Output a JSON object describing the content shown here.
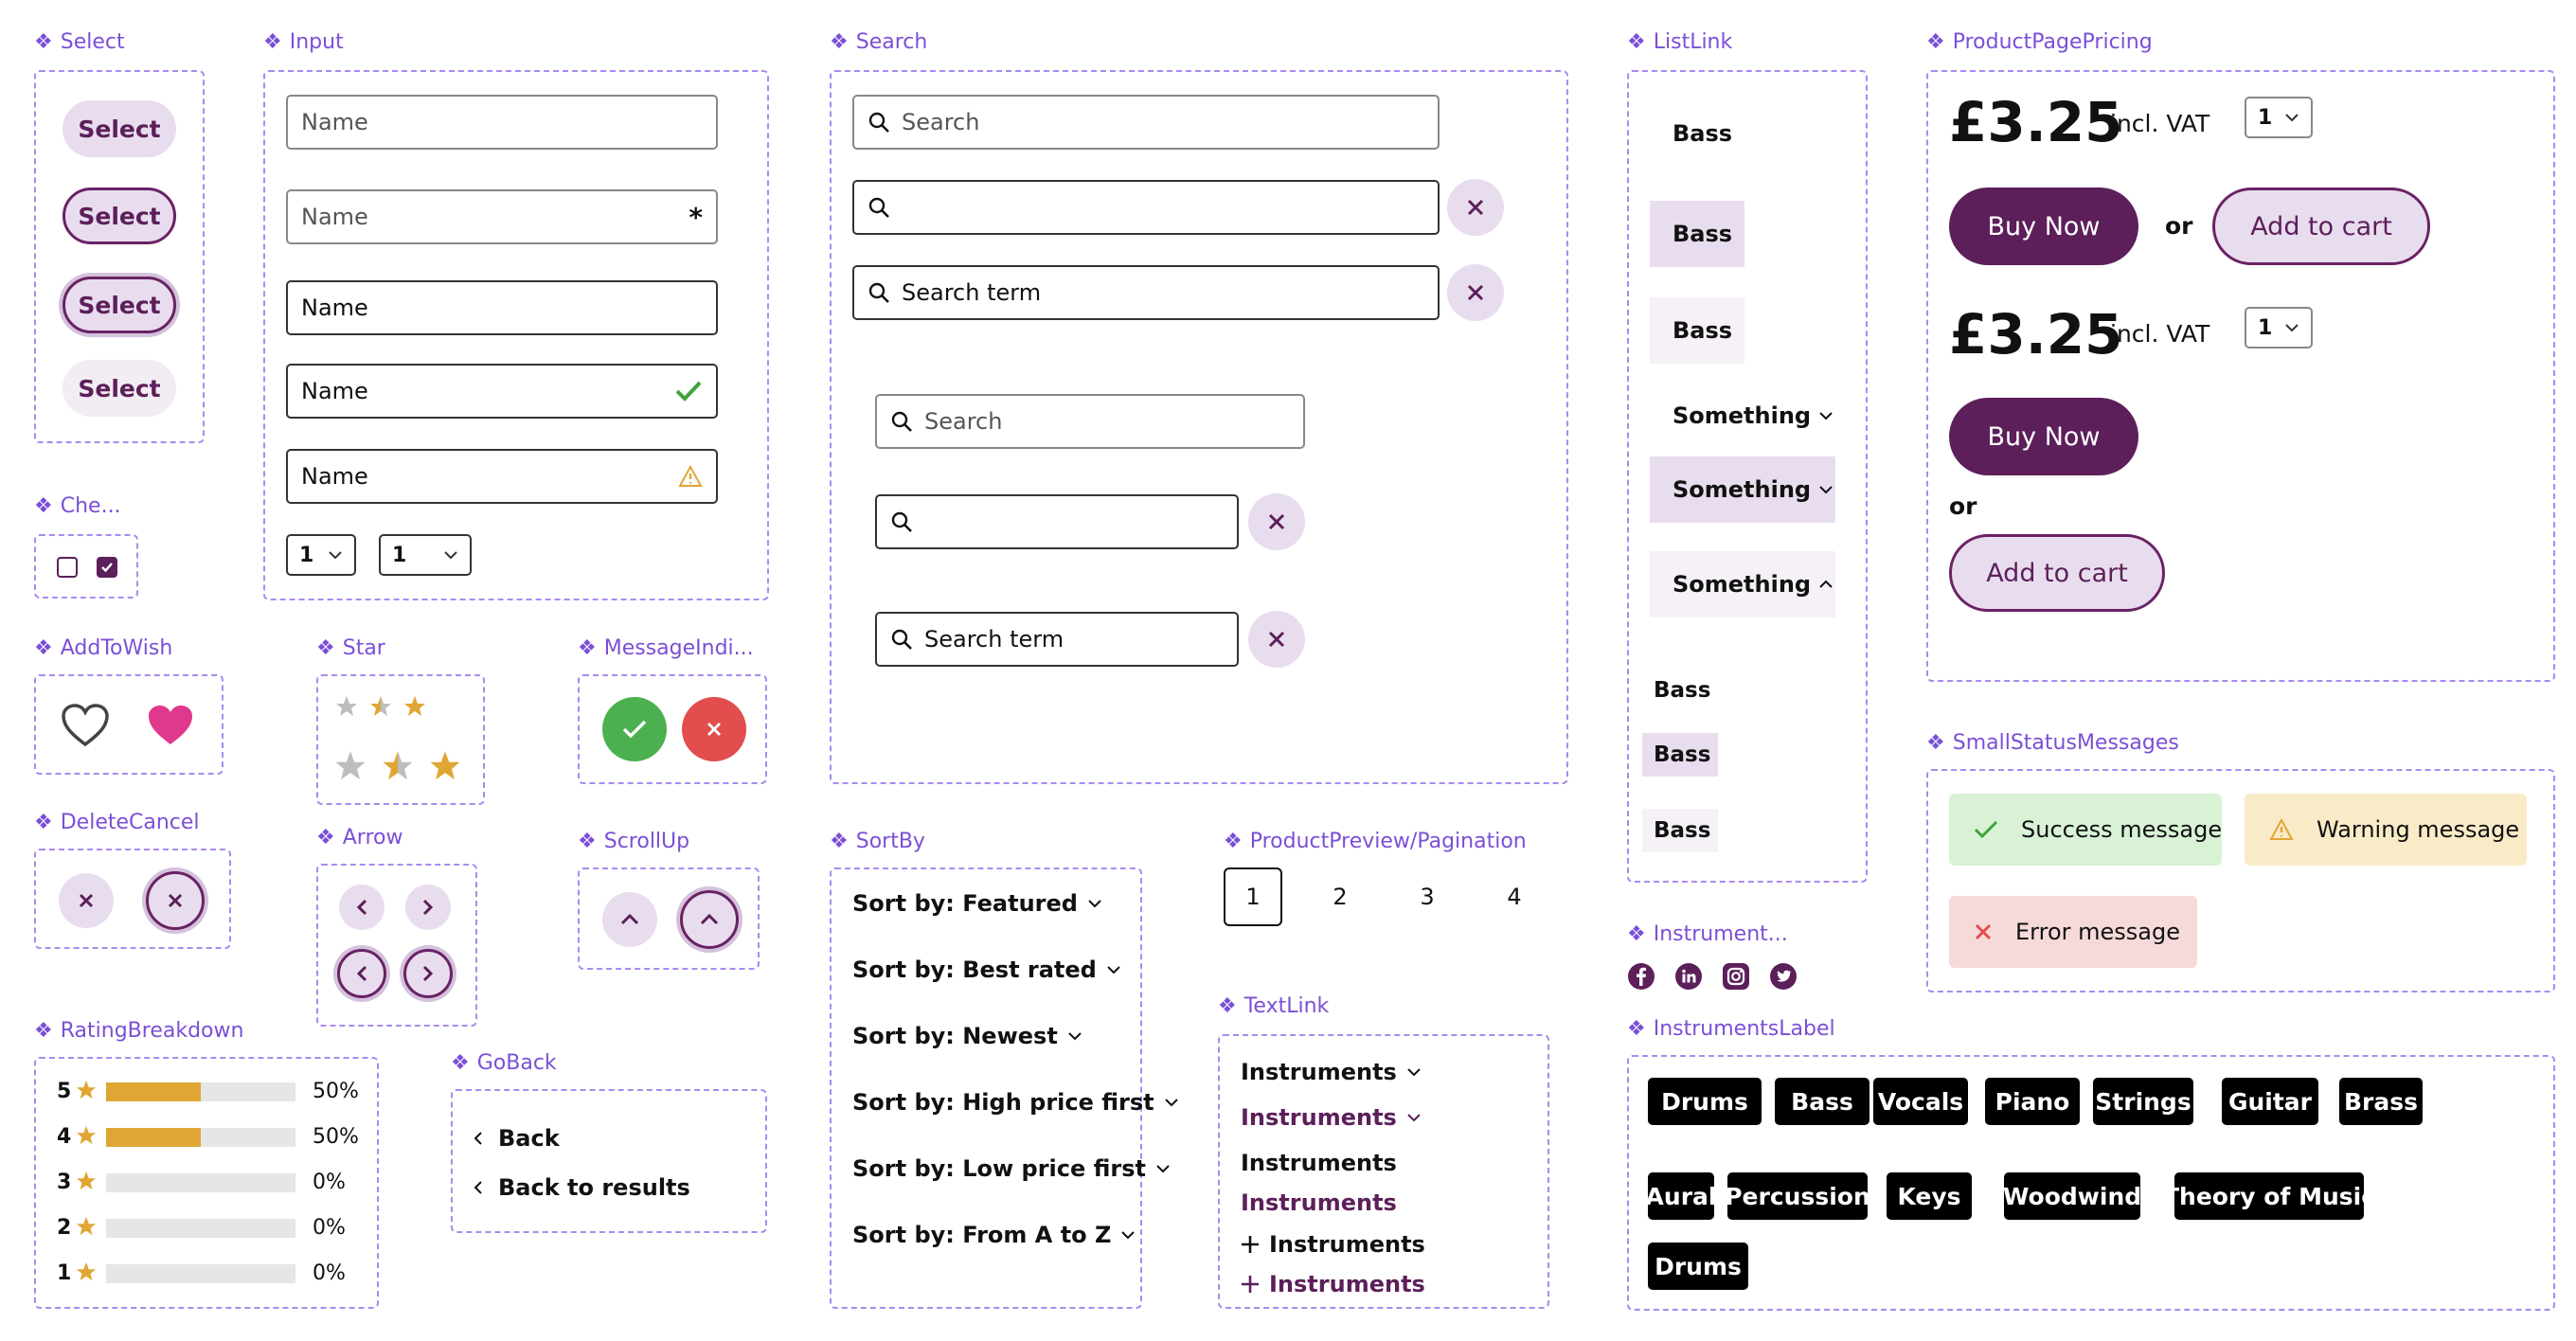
{
  "sections": {
    "select": "Select",
    "input": "Input",
    "search": "Search",
    "listlink": "ListLink",
    "pricing": "ProductPagePricing",
    "checkbox": "Che...",
    "addtowish": "AddToWish",
    "star": "Star",
    "messageindicator": "MessageIndi...",
    "deletecancel": "DeleteCancel",
    "arrow": "Arrow",
    "scrollup": "ScrollUp",
    "sortby": "SortBy",
    "pagination": "ProductPreview/Pagination",
    "statusmessages": "SmallStatusMessages",
    "instruments_social": "Instrument...",
    "textlink": "TextLink",
    "ratingbreakdown": "RatingBreakdown",
    "goback": "GoBack",
    "instrumentslabel": "InstrumentsLabel"
  },
  "select": {
    "buttons": [
      "Select",
      "Select",
      "Select",
      "Select"
    ]
  },
  "input": {
    "fields": [
      "Name",
      "Name",
      "Name",
      "Name",
      "Name"
    ],
    "required_mark": "*",
    "dropdowns": [
      "1",
      "1"
    ]
  },
  "search": {
    "placeholder": "Search",
    "term": "Search term"
  },
  "listlink": {
    "items": [
      "Bass",
      "Bass",
      "Bass",
      "Something",
      "Something",
      "Something",
      "Bass",
      "Bass",
      "Bass"
    ]
  },
  "pricing": {
    "price": "£3.25",
    "vat": "incl. VAT",
    "qty": "1",
    "buy_now": "Buy Now",
    "or": "or",
    "add_to_cart": "Add to cart"
  },
  "status": {
    "success": "Success message",
    "warning": "Warning message",
    "error": "Error message"
  },
  "sortby": {
    "options": [
      "Sort by: Featured",
      "Sort by: Best rated",
      "Sort by: Newest",
      "Sort by: High price first",
      "Sort by: Low price first",
      "Sort by: From A to Z"
    ]
  },
  "pagination": {
    "pages": [
      "1",
      "2",
      "3",
      "4"
    ],
    "current": 1
  },
  "textlink": {
    "items": [
      "Instruments",
      "Instruments",
      "Instruments",
      "Instruments",
      "Instruments",
      "Instruments"
    ]
  },
  "rating": {
    "rows": [
      {
        "stars": "5",
        "percent": "50%",
        "fraction": 0.5
      },
      {
        "stars": "4",
        "percent": "50%",
        "fraction": 0.5
      },
      {
        "stars": "3",
        "percent": "0%",
        "fraction": 0
      },
      {
        "stars": "2",
        "percent": "0%",
        "fraction": 0
      },
      {
        "stars": "1",
        "percent": "0%",
        "fraction": 0
      }
    ]
  },
  "goback": {
    "back": "Back",
    "back_results": "Back to results"
  },
  "instrument_labels": [
    "Drums",
    "Bass",
    "Vocals",
    "Piano",
    "Strings",
    "Guitar",
    "Brass",
    "Aural",
    "Percussion",
    "Keys",
    "Woodwind",
    "Theory of Music",
    "Drums"
  ],
  "social_icons": [
    "facebook-icon",
    "linkedin-icon",
    "instagram-icon",
    "twitter-icon"
  ],
  "colors": {
    "accent": "#7B4FD6",
    "brand": "#5C1F5A",
    "brand_light": "#E8DDEE",
    "star": "#E0A634",
    "success_bg": "#D9F2D6",
    "warning_bg": "#FAEBC8",
    "error_bg": "#F6DADA",
    "heart": "#E0388C"
  }
}
